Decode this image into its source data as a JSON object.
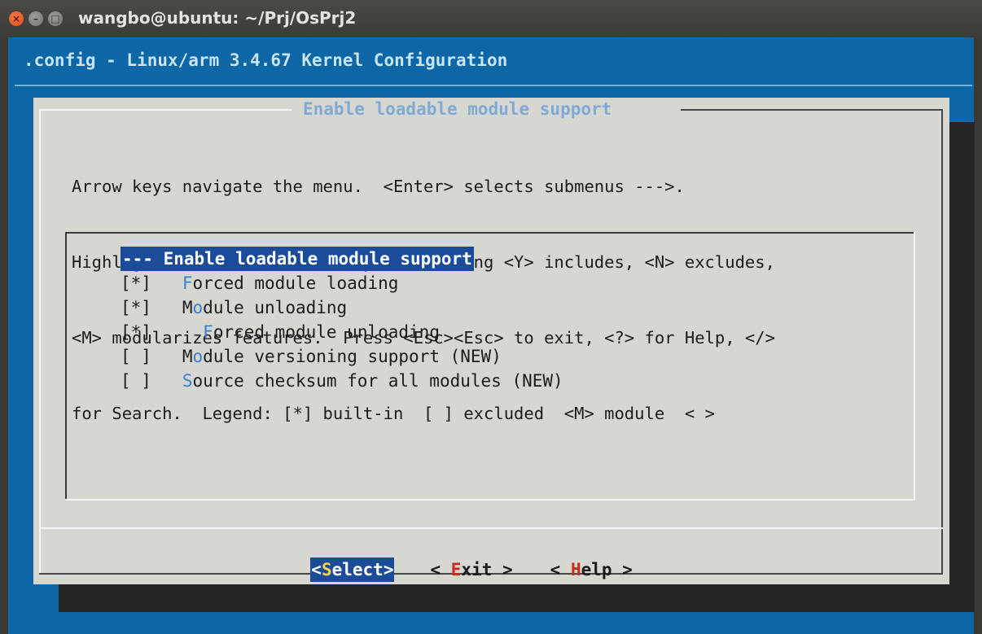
{
  "window": {
    "title": "wangbo@ubuntu: ~/Prj/OsPrj2",
    "close_glyph": "×",
    "min_glyph": "–",
    "max_glyph": "□"
  },
  "terminal": {
    "header": ".config - Linux/arm 3.4.67 Kernel Configuration"
  },
  "dialog": {
    "title": "Enable loadable module support",
    "help_lines": [
      "Arrow keys navigate the menu.  <Enter> selects submenus --->.",
      "Highlighted letters are hotkeys.  Pressing <Y> includes, <N> excludes,",
      "<M> modularizes features.  Press <Esc><Esc> to exit, <?> for Help, </>",
      "for Search.  Legend: [*] built-in  [ ] excluded  <M> module  < >"
    ],
    "menu_items": [
      {
        "text": "--- Enable loadable module support",
        "selected": true
      },
      {
        "prefix": "[*]   ",
        "hotkey": "F",
        "rest": "orced module loading"
      },
      {
        "prefix": "[*]   ",
        "hotkey": "M",
        "rest": "o",
        "hotkey2": "d",
        "rest2": "ule unloading"
      },
      {
        "prefix": "[*]     ",
        "hotkey": "F",
        "rest": "orced module unloading"
      },
      {
        "prefix": "[ ]   ",
        "hotkey": "M",
        "rest": "o",
        "hotkey2": "d",
        "rest2": "ule versioning support (NEW)"
      },
      {
        "prefix": "[ ]   ",
        "hotkey": "S",
        "rest": "ource checksum for all modules (NEW)"
      }
    ],
    "buttons": {
      "select": {
        "pre": "<",
        "hotkey": "S",
        "post": "elect>"
      },
      "exit": {
        "pre": "< ",
        "hotkey": "E",
        "post": "xit >"
      },
      "help": {
        "pre": "< ",
        "hotkey": "H",
        "post": "elp >"
      }
    }
  },
  "colors": {
    "terminal_bg": "#0d66a5",
    "dialog_bg": "#d6d7d0",
    "selection_bg": "#1b4c9a",
    "hotkey": "#3c7ed6",
    "button_hotkey": "#c62b1f",
    "selected_button_hotkey": "#f3d34a"
  }
}
